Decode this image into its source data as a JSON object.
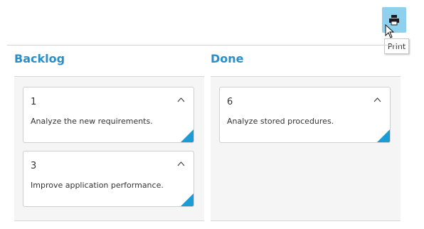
{
  "toolbar": {
    "print_icon": "printer-icon",
    "print_tooltip": "Print"
  },
  "columns": [
    {
      "title": "Backlog",
      "cards": [
        {
          "id": "1",
          "text": "Analyze the new requirements."
        },
        {
          "id": "3",
          "text": "Improve application performance."
        }
      ]
    },
    {
      "title": "Done",
      "cards": [
        {
          "id": "6",
          "text": "Analyze stored procedures."
        }
      ]
    }
  ],
  "colors": {
    "accent": "#2a8fc9",
    "card_corner": "#1a9dd6",
    "print_button_bg": "#8fd0ef"
  }
}
